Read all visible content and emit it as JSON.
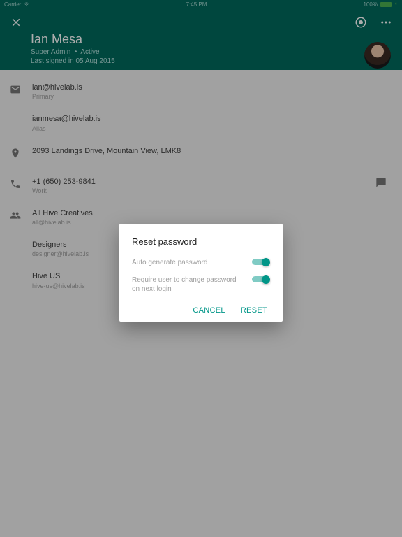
{
  "status_bar": {
    "carrier": "Carrier",
    "time": "7:45 PM",
    "battery_pct": "100%"
  },
  "header": {
    "name": "Ian Mesa",
    "role": "Super Admin",
    "status": "Active",
    "last_sign": "Last signed in 05 Aug 2015"
  },
  "emails": [
    {
      "address": "ian@hivelab.is",
      "label": "Primary"
    },
    {
      "address": "ianmesa@hivelab.is",
      "label": "Alias"
    }
  ],
  "address": "2093 Landings Drive, Mountain View, LMK8",
  "phone": {
    "number": "+1 (650) 253-9841",
    "label": "Work"
  },
  "groups": [
    {
      "name": "All Hive Creatives",
      "email": "all@hivelab.is"
    },
    {
      "name": "Designers",
      "email": "designer@hivelab.is"
    },
    {
      "name": "Hive US",
      "email": "hive-us@hivelab.is"
    }
  ],
  "dialog": {
    "title": "Reset password",
    "option_autogen": "Auto generate password",
    "option_require": "Require user to change password on next login",
    "cancel": "CANCEL",
    "reset": "RESET"
  }
}
